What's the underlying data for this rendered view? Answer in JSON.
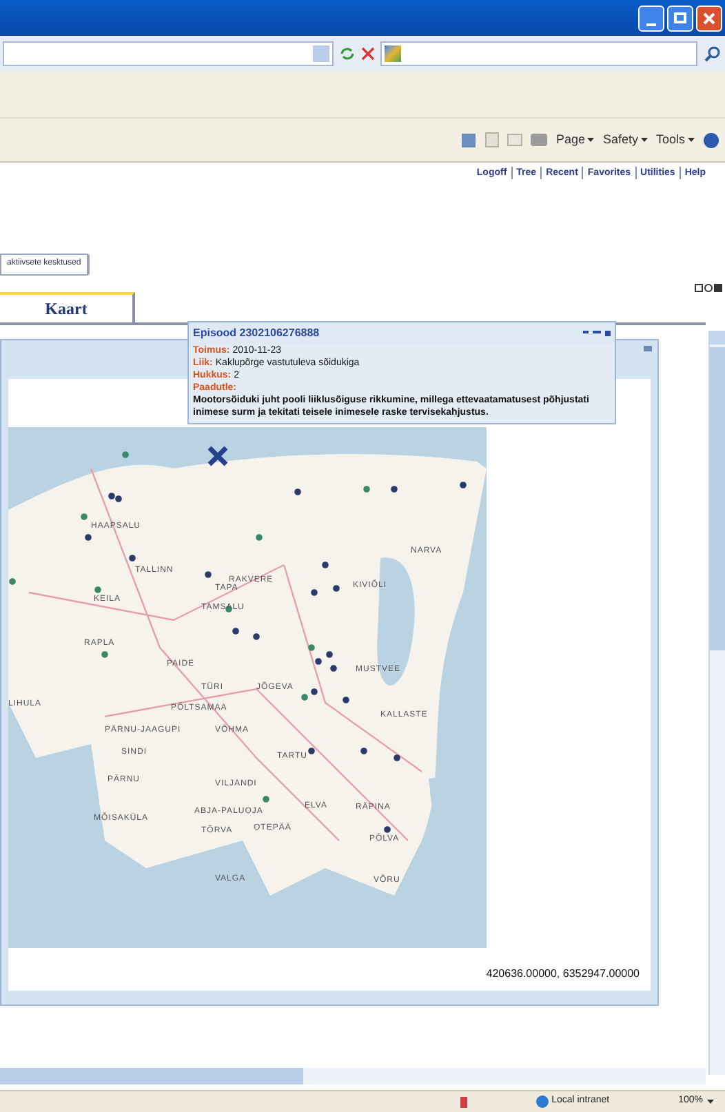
{
  "command_bar": {
    "menus": [
      "Page",
      "Safety",
      "Tools"
    ]
  },
  "top_links": [
    "Logoff",
    "Tree",
    "Recent",
    "Favorites",
    "Utilities",
    "Help"
  ],
  "filter_button": "aktiivsete kesktused",
  "tabs": [
    {
      "label": "Kaart",
      "selected": true
    }
  ],
  "popup": {
    "title": "Episood 2302106276888",
    "lines": [
      {
        "label": "Toimus:",
        "value": "2010-11-23"
      },
      {
        "label": "Liik:",
        "value": "Kaklupõrge vastutuleva sõidukiga"
      },
      {
        "label": "Hukkus:",
        "value": "2"
      },
      {
        "label": "Paadutle:"
      }
    ],
    "description": "Mootorsõiduki juht pooli liiklusõiguse rikkumine, millega ettevaatamatusest põhjustati inimese surm ja tekitati teisele inimesele raske tervisekahjustus."
  },
  "map_labels": [
    "HAAPSALU",
    "TALLINN",
    "RAKVERE",
    "NARVA",
    "KEILA",
    "TAPA",
    "TAMSALU",
    "KIVIÕLI",
    "RAPLA",
    "PAIDE",
    "MUSTVEE",
    "LIHULA",
    "TÜRI",
    "JÕGEVA",
    "PÕLTSAMAA",
    "KALLASTE",
    "PÄRNU-JAAGUPI",
    "VÕHMA",
    "SINDI",
    "TARTU",
    "PÄRNU",
    "VILJANDI",
    "MÕISAKÜLA",
    "ABJA-PALUOJA",
    "ELVA",
    "RÄPINA",
    "TÕRVA",
    "OTEPÄÄ",
    "PÕLVA",
    "VALGA",
    "VÕRU"
  ],
  "coordinates": "420636.00000, 6352947.00000",
  "status_bar": {
    "zone": "Local intranet",
    "zoom": "100%"
  }
}
